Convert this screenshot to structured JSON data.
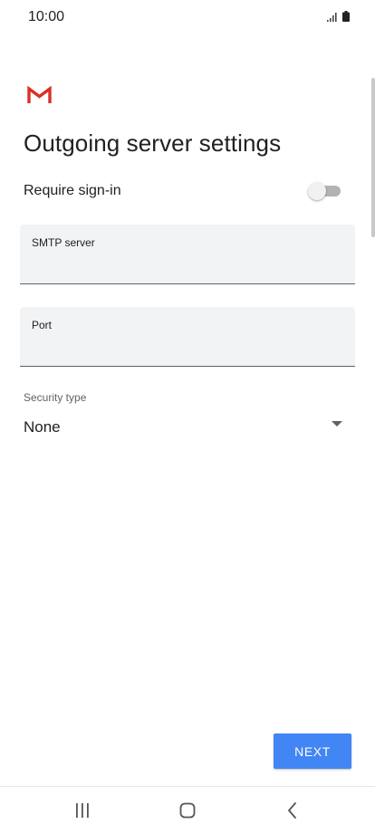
{
  "status_bar": {
    "time": "10:00",
    "icons": [
      "signal-icon",
      "battery-icon"
    ]
  },
  "app": {
    "logo": "gmail-logo",
    "title": "Outgoing server settings"
  },
  "require_signin": {
    "label": "Require sign-in",
    "enabled": false
  },
  "fields": {
    "smtp_server": {
      "label": "SMTP server",
      "value": ""
    },
    "port": {
      "label": "Port",
      "value": ""
    }
  },
  "security": {
    "label": "Security type",
    "selected": "None"
  },
  "actions": {
    "next_label": "NEXT"
  },
  "nav_bar": {
    "buttons": [
      "recent-apps-icon",
      "home-icon",
      "back-icon"
    ]
  },
  "colors": {
    "accent": "#4285f4",
    "gmail_red": "#d93025",
    "field_bg": "#f1f3f4"
  }
}
